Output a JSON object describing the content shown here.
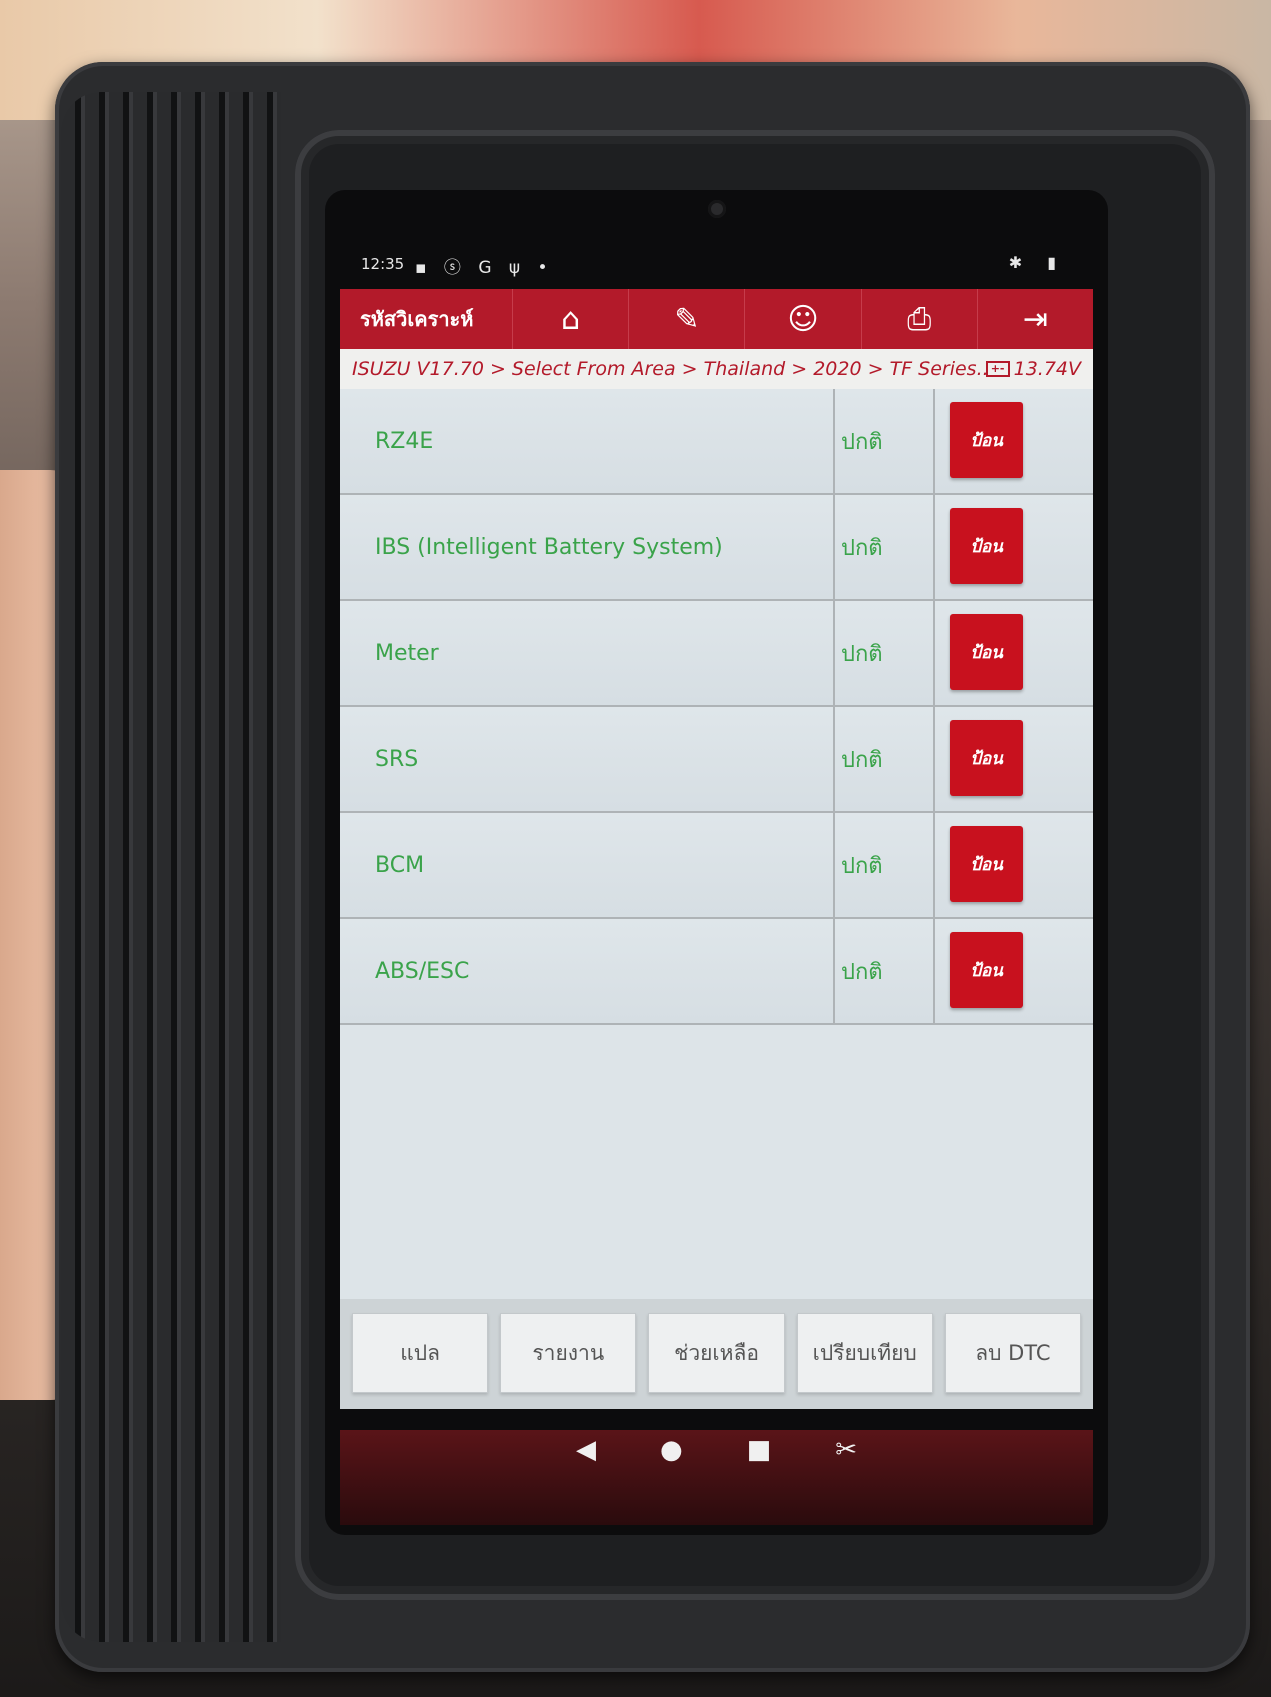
{
  "status_bar": {
    "time": "12:35",
    "left_icons": "▪ ⓢ G ψ •",
    "right_icons": "✱ ▮"
  },
  "toolbar": {
    "title": "รหัสวิเคราะห์",
    "buttons": [
      {
        "icon": "home-icon",
        "glyph": "⌂"
      },
      {
        "icon": "edit-icon",
        "glyph": "✎"
      },
      {
        "icon": "user-icon",
        "glyph": "☺"
      },
      {
        "icon": "print-icon",
        "glyph": "⎙"
      },
      {
        "icon": "exit-icon",
        "glyph": "⇥"
      }
    ]
  },
  "breadcrumb": {
    "path": "ISUZU V17.70 > Select From Area > Thailand > 2020 > TF Series...",
    "battery_glyph": "+-",
    "voltage": "13.74V"
  },
  "systems": [
    {
      "name": "RZ4E",
      "status": "ปกติ",
      "action": "ป้อน"
    },
    {
      "name": "IBS (Intelligent Battery System)",
      "status": "ปกติ",
      "action": "ป้อน"
    },
    {
      "name": "Meter",
      "status": "ปกติ",
      "action": "ป้อน"
    },
    {
      "name": "SRS",
      "status": "ปกติ",
      "action": "ป้อน"
    },
    {
      "name": "BCM",
      "status": "ปกติ",
      "action": "ป้อน"
    },
    {
      "name": "ABS/ESC",
      "status": "ปกติ",
      "action": "ป้อน"
    }
  ],
  "bottom_buttons": [
    "แปล",
    "รายงาน",
    "ช่วยเหลือ",
    "เปรียบเทียบ",
    "ลบ DTC"
  ],
  "nav_bar": {
    "back": "◀",
    "home": "●",
    "recents": "■",
    "screenshot": "✂"
  }
}
